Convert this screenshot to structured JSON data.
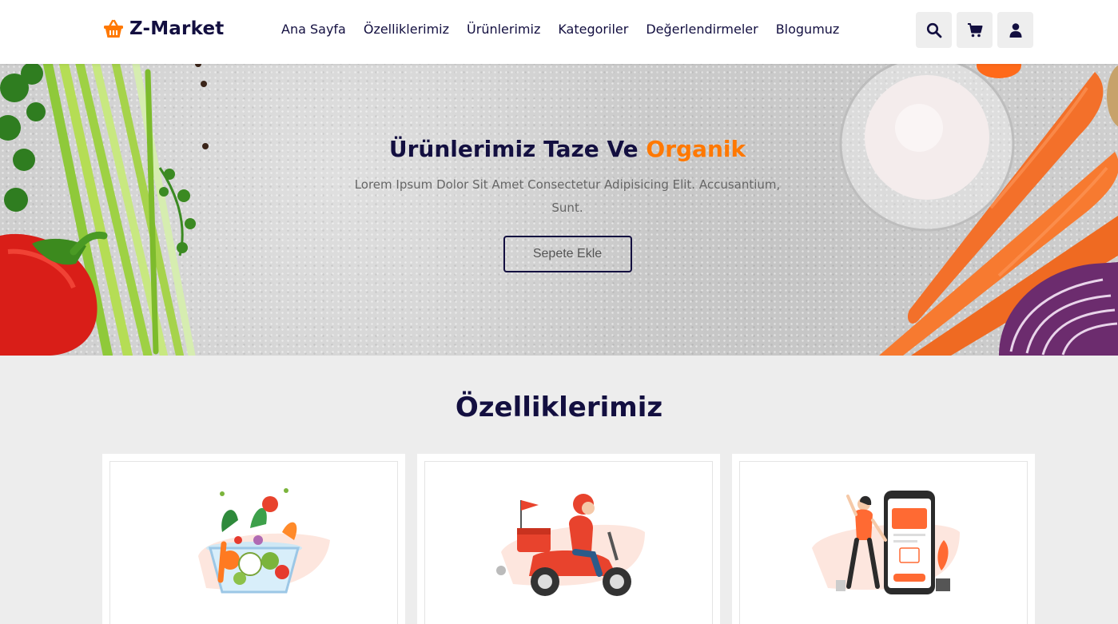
{
  "header": {
    "logo_text": "Z-Market",
    "nav": [
      "Ana Sayfa",
      "Özelliklerimiz",
      "Ürünlerimiz",
      "Kategoriler",
      "Değerlendirmeler",
      "Blogumuz"
    ],
    "icons": [
      "search-icon",
      "cart-icon",
      "user-icon"
    ]
  },
  "hero": {
    "title_main": "Ürünlerimiz Taze Ve",
    "title_accent": "Organik",
    "description": "Lorem Ipsum Dolor Sit Amet Consectetur Adipisicing Elit. Accusantium, Sunt.",
    "button_label": "Sepete Ekle"
  },
  "features": {
    "title": "Özelliklerimiz",
    "cards": [
      {
        "image": "salad-bowl-illustration"
      },
      {
        "image": "delivery-scooter-illustration"
      },
      {
        "image": "mobile-payment-illustration"
      }
    ]
  },
  "colors": {
    "accent": "#ff7800",
    "primary": "#130f40",
    "background": "#ededed"
  }
}
